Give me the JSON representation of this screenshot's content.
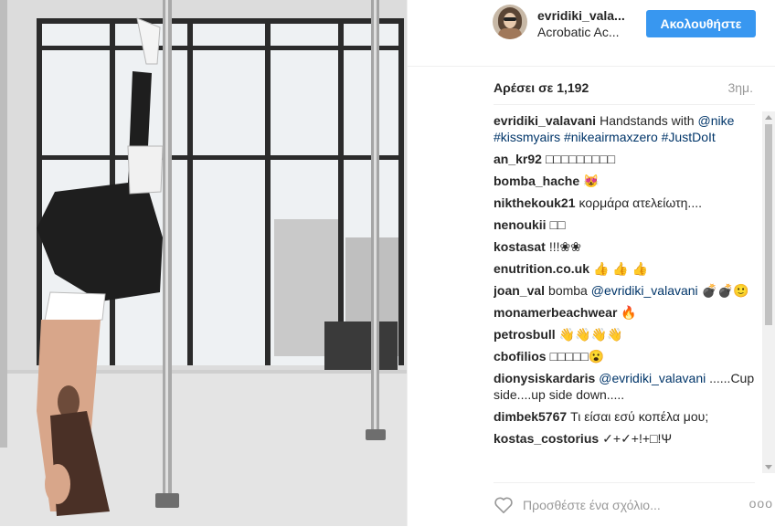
{
  "post": {
    "username": "evridiki_vala...",
    "subtitle": "Acrobatic Ac...",
    "follow_label": "Ακολουθήστε",
    "likes_text": "Αρέσει σε 1,192",
    "time_ago": "3ημ.",
    "add_comment_placeholder": "Προσθέστε ένα σχόλιο...",
    "more_label": "ooo"
  },
  "comments": [
    {
      "user": "evridiki_valavani",
      "parts": [
        {
          "text": "Handstands with ",
          "link": false
        },
        {
          "text": "@nike",
          "link": true
        },
        {
          "text": " ",
          "link": false
        },
        {
          "text": "#kissmyairs",
          "link": true
        },
        {
          "text": " ",
          "link": false
        },
        {
          "text": "#nikeairmaxzero",
          "link": true
        },
        {
          "text": " ",
          "link": false
        },
        {
          "text": "#JustDoIt",
          "link": true
        }
      ]
    },
    {
      "user": "an_kr92",
      "parts": [
        {
          "text": "□□□□□□□□□",
          "link": false
        }
      ]
    },
    {
      "user": "bomba_hache",
      "parts": [
        {
          "text": "😻",
          "link": false
        }
      ]
    },
    {
      "user": "nikthekouk21",
      "parts": [
        {
          "text": "κορμάρα ατελείωτη....",
          "link": false
        }
      ]
    },
    {
      "user": "nenoukii",
      "parts": [
        {
          "text": "□□",
          "link": false
        }
      ]
    },
    {
      "user": "kostasat",
      "parts": [
        {
          "text": "!!!❀❀",
          "link": false
        }
      ]
    },
    {
      "user": "enutrition.co.uk",
      "parts": [
        {
          "text": "👍 👍 👍",
          "link": false
        }
      ]
    },
    {
      "user": "joan_val",
      "parts": [
        {
          "text": "bomba ",
          "link": false
        },
        {
          "text": "@evridiki_valavani",
          "link": true
        },
        {
          "text": " 💣💣🙂",
          "link": false
        }
      ]
    },
    {
      "user": "monamerbeachwear",
      "parts": [
        {
          "text": "🔥",
          "link": false
        }
      ]
    },
    {
      "user": "petrosbull",
      "parts": [
        {
          "text": "👋👋👋👋",
          "link": false
        }
      ]
    },
    {
      "user": "cbofilios",
      "parts": [
        {
          "text": "□□□□□😮",
          "link": false
        }
      ]
    },
    {
      "user": "dionysiskardaris",
      "parts": [
        {
          "text": "@evridiki_valavani",
          "link": true
        },
        {
          "text": " ......Cup side....up side down.....",
          "link": false
        }
      ]
    },
    {
      "user": "dimbek5767",
      "parts": [
        {
          "text": "Τι είσαι εσύ κοπέλα μου;",
          "link": false
        }
      ]
    },
    {
      "user": "kostas_costorius",
      "parts": [
        {
          "text": "✓+✓+!+□!Ψ",
          "link": false
        }
      ]
    }
  ],
  "colors": {
    "follow_button": "#3897f0",
    "link": "#003569",
    "muted": "#999999"
  }
}
